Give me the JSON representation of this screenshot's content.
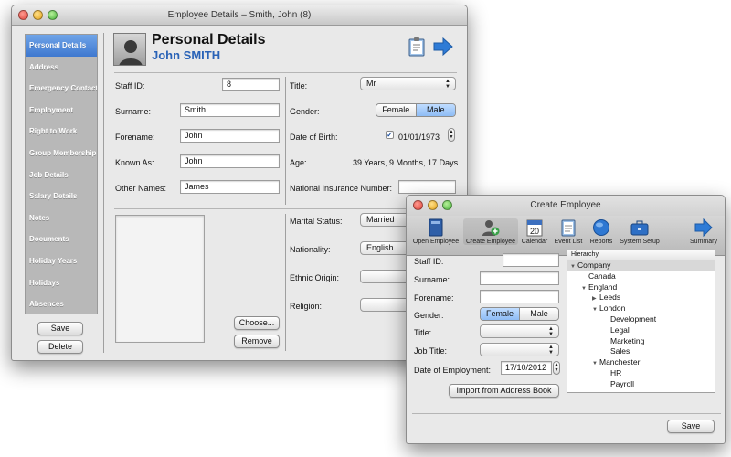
{
  "main_window": {
    "title": "Employee Details – Smith, John (8)",
    "sidebar": [
      {
        "label": "Personal Details",
        "selected": true
      },
      {
        "label": "Address"
      },
      {
        "label": "Emergency Contacts"
      },
      {
        "label": "Employment"
      },
      {
        "label": "Right to Work"
      },
      {
        "label": "Group Membership"
      },
      {
        "label": "Job Details"
      },
      {
        "label": "Salary Details"
      },
      {
        "label": "Notes"
      },
      {
        "label": "Documents"
      },
      {
        "label": "Holiday Years"
      },
      {
        "label": "Holidays"
      },
      {
        "label": "Absences"
      }
    ],
    "save_label": "Save",
    "delete_label": "Delete",
    "header": {
      "title": "Personal Details",
      "name": "John SMITH"
    },
    "fields": {
      "staff_id": {
        "label": "Staff ID:",
        "value": "8"
      },
      "surname": {
        "label": "Surname:",
        "value": "Smith"
      },
      "forename": {
        "label": "Forename:",
        "value": "John"
      },
      "known_as": {
        "label": "Known As:",
        "value": "John"
      },
      "other_names": {
        "label": "Other Names:",
        "value": "James"
      },
      "title": {
        "label": "Title:",
        "value": "Mr"
      },
      "gender": {
        "label": "Gender:",
        "options": [
          "Female",
          "Male"
        ],
        "selected": "Male"
      },
      "dob": {
        "label": "Date of Birth:",
        "value": "01/01/1973",
        "checked": true
      },
      "age": {
        "label": "Age:",
        "value": "39 Years, 9 Months, 17 Days"
      },
      "ni": {
        "label": "National Insurance Number:",
        "value": ""
      },
      "marital": {
        "label": "Marital Status:",
        "value": "Married"
      },
      "nationality": {
        "label": "Nationality:",
        "value": "English"
      },
      "ethnic": {
        "label": "Ethnic Origin:",
        "value": ""
      },
      "religion": {
        "label": "Religion:",
        "value": ""
      }
    },
    "choose_label": "Choose...",
    "remove_label": "Remove"
  },
  "create_window": {
    "title": "Create Employee",
    "toolbar": [
      {
        "label": "Open Employee",
        "icon": "book-icon"
      },
      {
        "label": "Create Employee",
        "icon": "add-person-icon",
        "selected": true
      },
      {
        "label": "Calendar",
        "icon": "calendar-icon",
        "day": "20"
      },
      {
        "label": "Event List",
        "icon": "clipboard-icon"
      },
      {
        "label": "Reports",
        "icon": "globe-icon"
      },
      {
        "label": "System Setup",
        "icon": "toolbox-icon"
      },
      {
        "label": "Summary",
        "icon": "arrow-right-icon"
      }
    ],
    "fields": {
      "staff_id": {
        "label": "Staff ID:",
        "value": ""
      },
      "surname": {
        "label": "Surname:",
        "value": ""
      },
      "forename": {
        "label": "Forename:",
        "value": ""
      },
      "gender": {
        "label": "Gender:",
        "options": [
          "Female",
          "Male"
        ],
        "selected": "Female"
      },
      "title": {
        "label": "Title:",
        "value": ""
      },
      "job_title": {
        "label": "Job Title:",
        "value": ""
      },
      "date_employment": {
        "label": "Date of Employment:",
        "value": "17/10/2012"
      }
    },
    "import_label": "Import from Address Book",
    "save_label": "Save",
    "hierarchy": {
      "header": "Hierarchy",
      "rows": [
        {
          "label": "Company",
          "level": 0,
          "expanded": true,
          "selected": true
        },
        {
          "label": "Canada",
          "level": 1
        },
        {
          "label": "England",
          "level": 1,
          "expanded": true
        },
        {
          "label": "Leeds",
          "level": 2,
          "collapsed": true
        },
        {
          "label": "London",
          "level": 2,
          "expanded": true
        },
        {
          "label": "Development",
          "level": 3
        },
        {
          "label": "Legal",
          "level": 3
        },
        {
          "label": "Marketing",
          "level": 3
        },
        {
          "label": "Sales",
          "level": 3
        },
        {
          "label": "Manchester",
          "level": 2,
          "expanded": true
        },
        {
          "label": "HR",
          "level": 3
        },
        {
          "label": "Payroll",
          "level": 3
        }
      ]
    }
  }
}
